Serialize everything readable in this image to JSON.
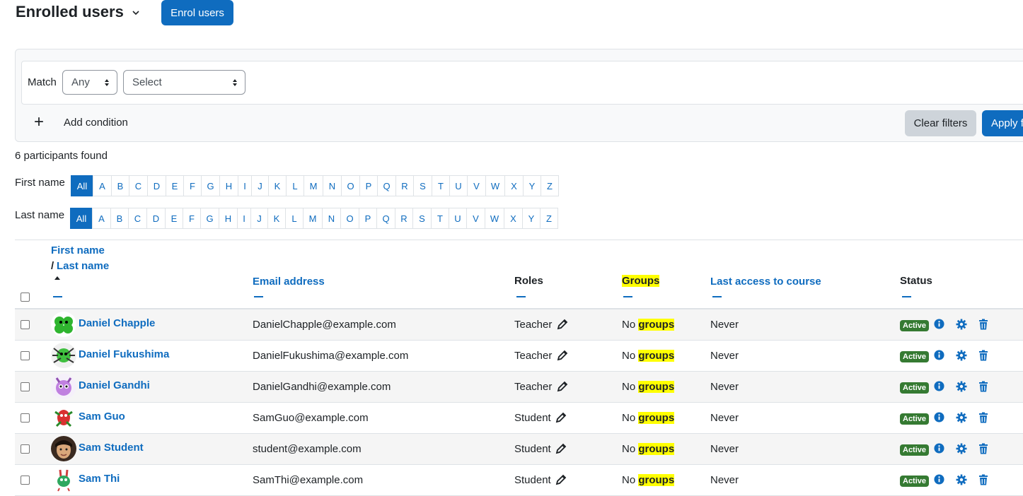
{
  "header": {
    "title": "Enrolled users",
    "enrol_label": "Enrol users"
  },
  "filter": {
    "match_label": "Match",
    "match_value": "Any",
    "field_value": "Select",
    "add_condition": "Add condition",
    "clear_label": "Clear filters",
    "apply_label": "Apply filters"
  },
  "count_text": "6 participants found",
  "initials": {
    "first_label": "First name",
    "last_label": "Last name",
    "letters": [
      "All",
      "A",
      "B",
      "C",
      "D",
      "E",
      "F",
      "G",
      "H",
      "I",
      "J",
      "K",
      "L",
      "M",
      "N",
      "O",
      "P",
      "Q",
      "R",
      "S",
      "T",
      "U",
      "V",
      "W",
      "X",
      "Y",
      "Z"
    ]
  },
  "table": {
    "headers": {
      "first_name": "First name",
      "slash": "/",
      "last_name": "Last name",
      "email": "Email address",
      "roles": "Roles",
      "groups": "Groups",
      "last_access": "Last access to course",
      "status": "Status"
    },
    "rows": [
      {
        "name": "Daniel Chapple",
        "email": "DanielChapple@example.com",
        "role": "Teacher",
        "groups_no": "No",
        "groups_word": "groups",
        "access": "Never",
        "status": "Active",
        "avatar": "green-clover"
      },
      {
        "name": "Daniel Fukushima",
        "email": "DanielFukushima@example.com",
        "role": "Teacher",
        "groups_no": "No",
        "groups_word": "groups",
        "access": "Never",
        "status": "Active",
        "avatar": "green-spider"
      },
      {
        "name": "Daniel Gandhi",
        "email": "DanielGandhi@example.com",
        "role": "Teacher",
        "groups_no": "No",
        "groups_word": "groups",
        "access": "Never",
        "status": "Active",
        "avatar": "purple-monster"
      },
      {
        "name": "Sam Guo",
        "email": "SamGuo@example.com",
        "role": "Student",
        "groups_no": "No",
        "groups_word": "groups",
        "access": "Never",
        "status": "Active",
        "avatar": "red-creature"
      },
      {
        "name": "Sam Student",
        "email": "student@example.com",
        "role": "Student",
        "groups_no": "No",
        "groups_word": "groups",
        "access": "Never",
        "status": "Active",
        "avatar": "photo"
      },
      {
        "name": "Sam Thi",
        "email": "SamThi@example.com",
        "role": "Student",
        "groups_no": "No",
        "groups_word": "groups",
        "access": "Never",
        "status": "Active",
        "avatar": "green-rabbit"
      }
    ]
  },
  "colors": {
    "primary": "#0f6cbf",
    "success": "#357a32",
    "highlight": "#ffff00"
  }
}
